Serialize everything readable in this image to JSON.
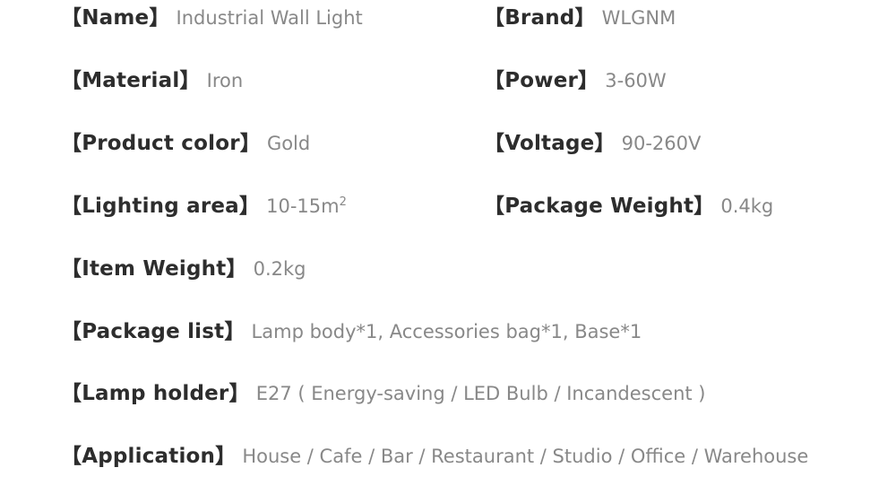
{
  "document": {
    "type": "product-specification",
    "bracket_open": "【",
    "bracket_close": "】",
    "colors": {
      "background": "#ffffff",
      "label": "#2d2d2d",
      "value": "#888888"
    }
  },
  "rows": [
    {
      "left": {
        "label": "【Name】",
        "value": "Industrial Wall Light",
        "name": "name"
      },
      "right": {
        "label": "【Brand】",
        "value": "WLGNM",
        "name": "brand"
      }
    },
    {
      "left": {
        "label": "【Material】",
        "value": "Iron",
        "name": "material"
      },
      "right": {
        "label": "【Power】",
        "value": "3-60W",
        "name": "power"
      }
    },
    {
      "left": {
        "label": "【Product color】",
        "value": "Gold",
        "name": "product-color"
      },
      "right": {
        "label": "【Voltage】",
        "value": "90-260V",
        "name": "voltage"
      }
    },
    {
      "left": {
        "label": "【Lighting area】",
        "value": "10-15m",
        "value_sup": "2",
        "name": "lighting-area"
      },
      "right": {
        "label": "【Package Weight】",
        "value": "0.4kg",
        "name": "package-weight"
      }
    },
    {
      "full": {
        "label": "【Item Weight】",
        "value": "0.2kg",
        "name": "item-weight"
      }
    },
    {
      "full": {
        "label": "【Package list】",
        "value": "Lamp body*1, Accessories bag*1, Base*1",
        "name": "package-list"
      }
    },
    {
      "full": {
        "label": "【Lamp holder】",
        "value": "E27 ( Energy-saving / LED Bulb / Incandescent )",
        "name": "lamp-holder"
      }
    },
    {
      "full": {
        "label": "【Application】",
        "value": "House / Cafe / Bar / Restaurant / Studio / Office / Warehouse",
        "name": "application"
      }
    }
  ]
}
